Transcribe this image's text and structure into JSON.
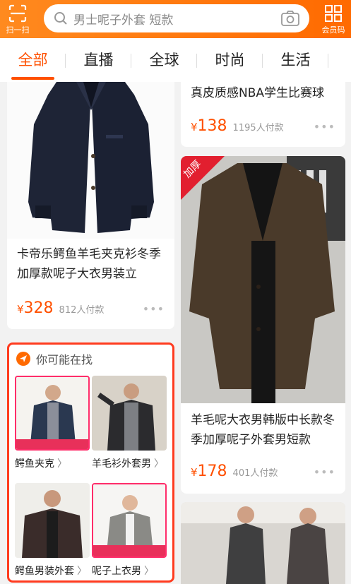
{
  "header": {
    "scan_label": "扫一扫",
    "member_label": "会员码",
    "search_value": "男士呢子外套 短款"
  },
  "tabs": [
    "全部",
    "直播",
    "全球",
    "时尚",
    "生活"
  ],
  "feed": {
    "left": [
      {
        "title": "卡帝乐鳄鱼羊毛夹克衫冬季加厚款呢子大衣男装立",
        "currency": "¥",
        "price": "328",
        "sold": "812人付款",
        "more": "•••"
      }
    ],
    "right": [
      {
        "title": "真皮质感NBA学生比赛球",
        "currency": "¥",
        "price": "138",
        "sold": "1195人付款",
        "more": "•••"
      },
      {
        "badge": "加厚",
        "title": "羊毛呢大衣男韩版中长款冬季加厚呢子外套男短款",
        "currency": "¥",
        "price": "178",
        "sold": "401人付款",
        "more": "•••"
      }
    ]
  },
  "recommend": {
    "heading": "你可能在找",
    "items": [
      {
        "label": "鳄鱼夹克",
        "arrow": "〉"
      },
      {
        "label": "羊毛衫外套男",
        "arrow": "〉"
      },
      {
        "label": "鳄鱼男装外套",
        "arrow": "〉"
      },
      {
        "label": "呢子上衣男",
        "arrow": "〉"
      }
    ]
  },
  "colors": {
    "accent": "#ff5000",
    "header": "#ff7a12",
    "highlight_border": "#ff3b1f"
  }
}
